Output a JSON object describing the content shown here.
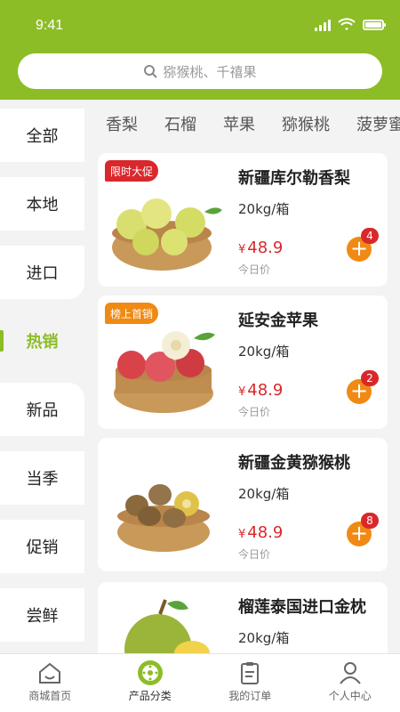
{
  "status_bar": {
    "time": "9:41"
  },
  "search": {
    "placeholder": "猕猴桃、千禧果"
  },
  "sidebar": {
    "items": [
      {
        "label": "全部",
        "active": false
      },
      {
        "label": "本地",
        "active": false
      },
      {
        "label": "进口",
        "active": false
      },
      {
        "label": "热销",
        "active": true
      },
      {
        "label": "新品",
        "active": false
      },
      {
        "label": "当季",
        "active": false
      },
      {
        "label": "促销",
        "active": false
      },
      {
        "label": "尝鲜",
        "active": false
      }
    ]
  },
  "tabs": [
    "香梨",
    "石榴",
    "苹果",
    "猕猴桃",
    "菠萝蜜"
  ],
  "products": [
    {
      "badge": "限时大促",
      "badge_color": "#d9282b",
      "name": "新疆库尔勒香梨",
      "spec": "20kg/箱",
      "currency": "¥",
      "price": "48.9",
      "price_label": "今日价",
      "cart_count": "4",
      "image": "pear-basket-icon"
    },
    {
      "badge": "榜上首销",
      "badge_color": "#f08a14",
      "name": "延安金苹果",
      "spec": "20kg/箱",
      "currency": "¥",
      "price": "48.9",
      "price_label": "今日价",
      "cart_count": "2",
      "image": "apple-basket-icon"
    },
    {
      "badge": "",
      "name": "新疆金黄猕猴桃",
      "spec": "20kg/箱",
      "currency": "¥",
      "price": "48.9",
      "price_label": "今日价",
      "cart_count": "8",
      "image": "kiwi-basket-icon"
    },
    {
      "badge": "",
      "name": "榴莲泰国进口金枕",
      "spec": "20kg/箱",
      "image": "durian-icon"
    }
  ],
  "bottom_nav": [
    {
      "label": "商城首页",
      "icon": "home-icon",
      "active": false
    },
    {
      "label": "产品分类",
      "icon": "category-icon",
      "active": true
    },
    {
      "label": "我的订单",
      "icon": "orders-icon",
      "active": false
    },
    {
      "label": "个人中心",
      "icon": "user-icon",
      "active": false
    }
  ],
  "colors": {
    "brand_green": "#8cbd27",
    "price_red": "#d9282b",
    "accent_orange": "#f08a14"
  }
}
